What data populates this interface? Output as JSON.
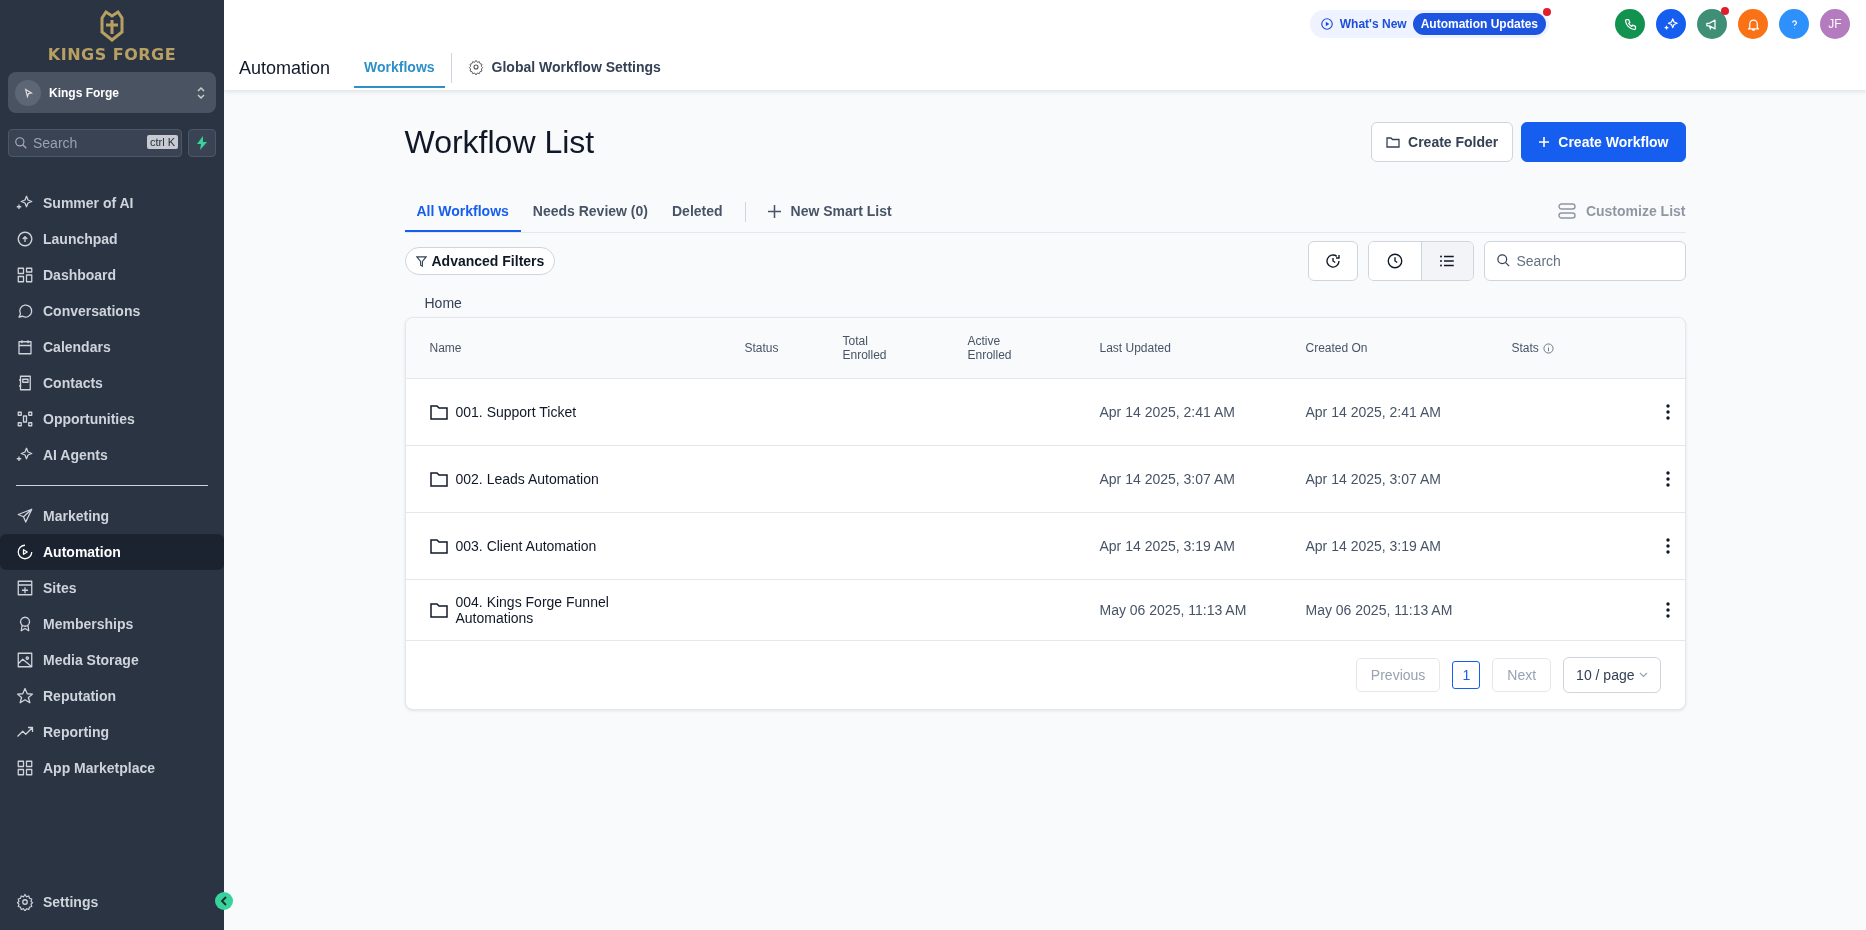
{
  "sidebar": {
    "logo_text": "KINGS FORGE",
    "account": {
      "name": "Kings Forge"
    },
    "search": {
      "placeholder": "Search",
      "shortcut": "ctrl K"
    },
    "items": [
      {
        "label": "Summer of AI",
        "selected": false
      },
      {
        "label": "Launchpad",
        "selected": false
      },
      {
        "label": "Dashboard",
        "selected": false
      },
      {
        "label": "Conversations",
        "selected": false
      },
      {
        "label": "Calendars",
        "selected": false
      },
      {
        "label": "Contacts",
        "selected": false
      },
      {
        "label": "Opportunities",
        "selected": false
      },
      {
        "label": "AI Agents",
        "selected": false
      }
    ],
    "items_2": [
      {
        "label": "Marketing",
        "selected": false
      },
      {
        "label": "Automation",
        "selected": true
      },
      {
        "label": "Sites",
        "selected": false
      },
      {
        "label": "Memberships",
        "selected": false
      },
      {
        "label": "Media Storage",
        "selected": false
      },
      {
        "label": "Reputation",
        "selected": false
      },
      {
        "label": "Reporting",
        "selected": false
      },
      {
        "label": "App Marketplace",
        "selected": false
      }
    ],
    "footer": {
      "label": "Settings"
    }
  },
  "header": {
    "title": "Automation",
    "tabs": [
      {
        "label": "Workflows",
        "selected": true
      },
      {
        "label": "Global Workflow Settings",
        "selected": false
      }
    ],
    "whats_new": {
      "label": "What's New",
      "badge": "Automation Updates",
      "notification": true
    },
    "action_icons": [
      {
        "color": "#12924f",
        "notification": false
      },
      {
        "color": "#155eef",
        "notification": false
      },
      {
        "color": "#3f8f76",
        "notification": true
      },
      {
        "color": "#f97316",
        "notification": false
      },
      {
        "color": "#2e90fa",
        "notification": false
      }
    ],
    "avatar": {
      "initials": "JF",
      "color": "#b57bbf"
    }
  },
  "page": {
    "title": "Workflow List",
    "buttons": [
      {
        "label": "Create Folder",
        "kind": "secondary"
      },
      {
        "label": "Create Workflow",
        "kind": "primary"
      }
    ],
    "tabs": [
      {
        "label": "All Workflows",
        "selected": true
      },
      {
        "label": "Needs Review (0)",
        "selected": false
      },
      {
        "label": "Deleted",
        "selected": false
      }
    ],
    "new_smart_list": "New Smart List",
    "customize_list": {
      "label": "Customize List",
      "disabled": true
    },
    "advanced_filters": "Advanced Filters",
    "view_toggle": [
      {
        "selected": false
      },
      {
        "selected": true
      }
    ],
    "search": {
      "placeholder": "Search"
    },
    "breadcrumb": "Home"
  },
  "table": {
    "columns": [
      "Name",
      "Status",
      "Total Enrolled",
      "Active Enrolled",
      "Last Updated",
      "Created On",
      "Stats"
    ],
    "rows": [
      {
        "name": "001. Support Ticket",
        "last_updated": "Apr 14 2025, 2:41 AM",
        "created_on": "Apr 14 2025, 2:41 AM"
      },
      {
        "name": "002. Leads Automation",
        "last_updated": "Apr 14 2025, 3:07 AM",
        "created_on": "Apr 14 2025, 3:07 AM"
      },
      {
        "name": "003. Client Automation",
        "last_updated": "Apr 14 2025, 3:19 AM",
        "created_on": "Apr 14 2025, 3:19 AM"
      },
      {
        "name": "004. Kings Forge Funnel Automations",
        "last_updated": "May 06 2025, 11:13 AM",
        "created_on": "May 06 2025, 11:13 AM"
      }
    ]
  },
  "pagination": {
    "previous": {
      "label": "Previous",
      "disabled": true
    },
    "pages": [
      {
        "label": "1",
        "selected": true
      }
    ],
    "next": {
      "label": "Next",
      "disabled": true
    },
    "page_size": "10 / page"
  }
}
